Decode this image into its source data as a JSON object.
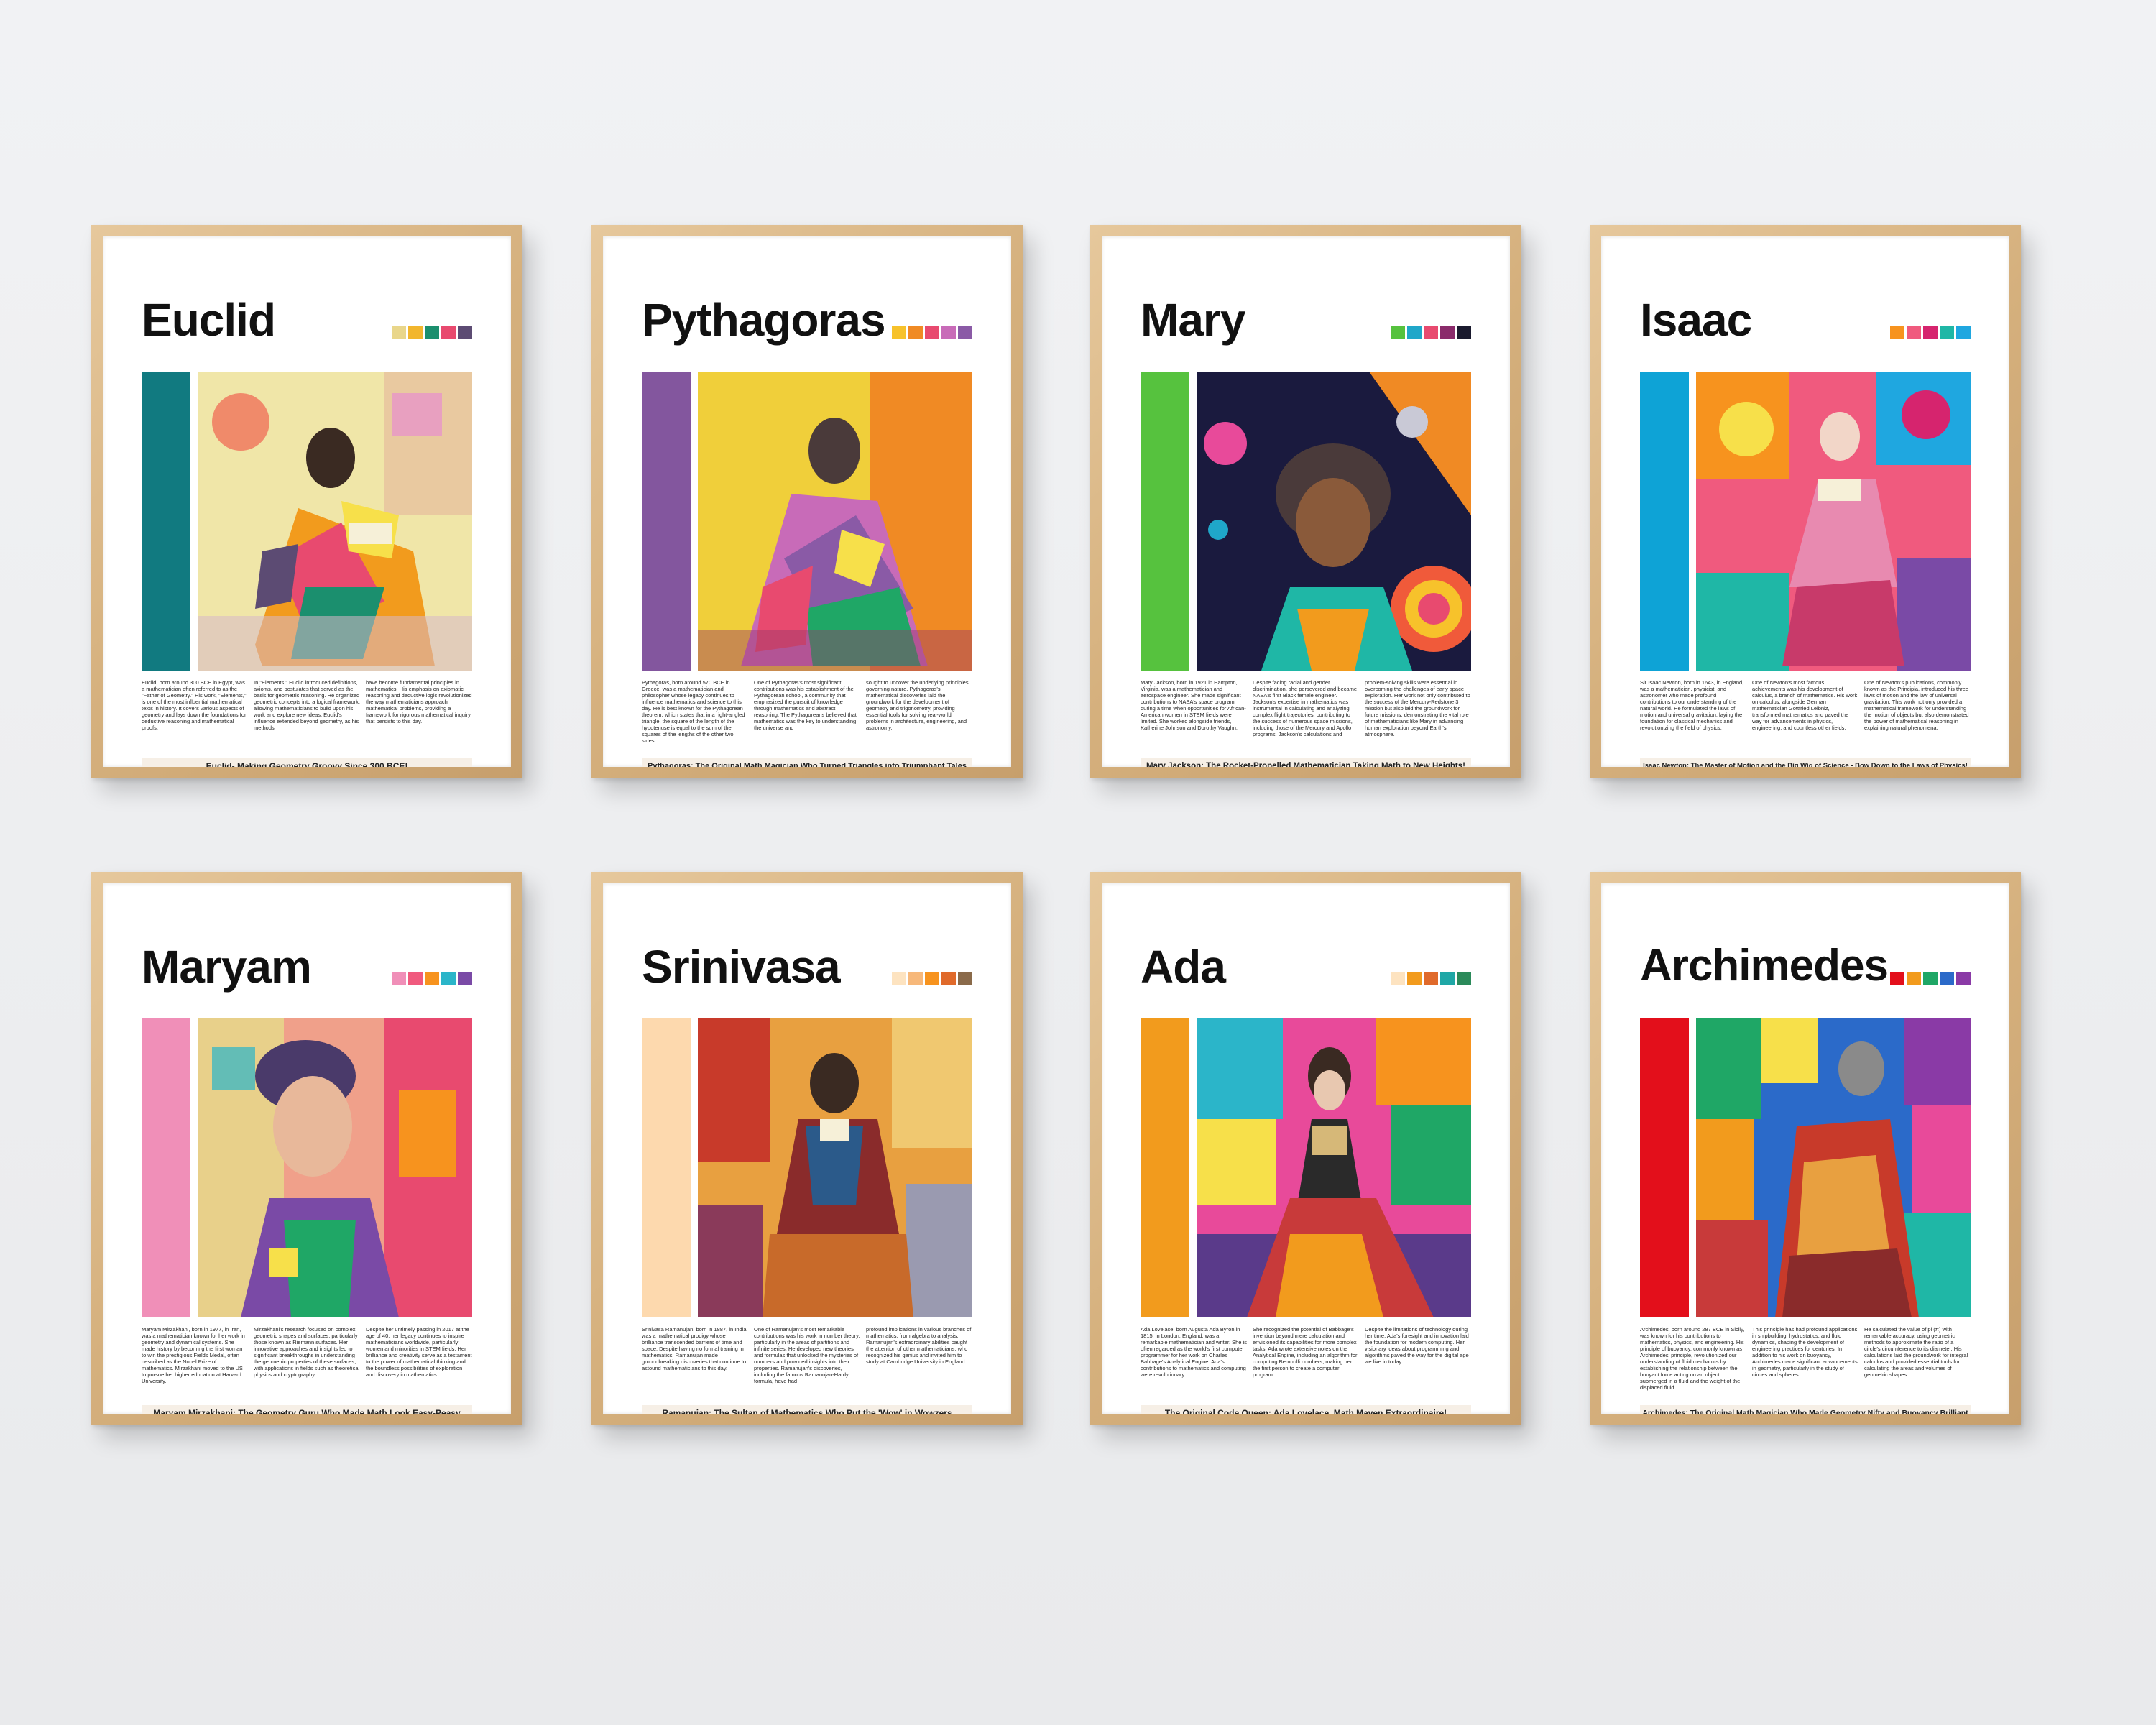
{
  "posters": [
    {
      "name": "Euclid",
      "sidebar_color": "#117a80",
      "swatches": [
        "#e9d68a",
        "#f2b62d",
        "#1b8f6e",
        "#e84a6f",
        "#5c4b73"
      ],
      "mini_swatches": [
        "#e9d68a",
        "#f2b62d",
        "#e84a6f"
      ],
      "bio": [
        "Euclid, born around 300 BCE in Egypt, was a mathematician often referred to as the \"Father of Geometry.\" His work, \"Elements,\" is one of the most influential mathematical texts in history. It covers various aspects of geometry and lays down the foundations for deductive reasoning and mathematical proofs.",
        "In \"Elements,\" Euclid introduced definitions, axioms, and postulates that served as the basis for geometric reasoning. He organized geometric concepts into a logical framework, allowing mathematicians to build upon his work and explore new ideas. Euclid's influence extended beyond geometry, as his methods",
        "have become fundamental principles in mathematics. His emphasis on axiomatic reasoning and deductive logic revolutionized the way mathematicians approach mathematical problems, providing a framework for rigorous mathematical inquiry that persists to this day."
      ],
      "tagline": "Euclid- Making Geometry Groovy Since 300 BCE!"
    },
    {
      "name": "Pythagoras",
      "sidebar_color": "#83569e",
      "swatches": [
        "#f7c22b",
        "#f08a24",
        "#e84a6f",
        "#c86bb8",
        "#8a5aa6"
      ],
      "mini_swatches": [
        "#f08a24",
        "#c86bb8",
        "#8a5aa6"
      ],
      "bio": [
        "Pythagoras, born around 570 BCE in Greece, was a mathematician and philosopher whose legacy continues to influence mathematics and science to this day. He is best known for the Pythagorean theorem, which states that in a right-angled triangle, the square of the length of the hypotenuse is equal to the sum of the squares of the lengths of the other two sides.",
        "One of Pythagoras's most significant contributions was his establishment of the Pythagorean school, a community that emphasized the pursuit of knowledge through mathematics and abstract reasoning. The Pythagoreans believed that mathematics was the key to understanding the universe and",
        "sought to uncover the underlying principles governing nature. Pythagoras's mathematical discoveries laid the groundwork for the development of geometry and trigonometry, providing essential tools for solving real-world problems in architecture, engineering, and astronomy."
      ],
      "tagline": "Pythagoras: The Original Math Magician Who Turned Triangles into Triumphant Tales"
    },
    {
      "name": "Mary",
      "sidebar_color": "#56c23e",
      "swatches": [
        "#56c23e",
        "#1fa7c9",
        "#e84a6f",
        "#8a2b6b",
        "#1a1a2e"
      ],
      "mini_swatches": [
        "#56c23e",
        "#e84a6f",
        "#1fa7c9"
      ],
      "bio": [
        "Mary Jackson, born in 1921 in Hampton, Virginia, was a mathematician and aerospace engineer. She made significant contributions to NASA's space program during a time when opportunities for African-American women in STEM fields were limited. She worked alongside friends, Katherine Johnson and Dorothy Vaughn.",
        "Despite facing racial and gender discrimination, she persevered and became NASA's first Black female engineer. Jackson's expertise in mathematics was instrumental in calculating and analyzing complex flight trajectories, contributing to the success of numerous space missions, including those of the Mercury and Apollo programs. Jackson's calculations and",
        "problem-solving skills were essential in overcoming the challenges of early space exploration. Her work not only contributed to the success of the Mercury-Redstone 3 mission but also laid the groundwork for future missions, demonstrating the vital role of mathematicians like Mary in advancing human exploration beyond Earth's atmosphere."
      ],
      "tagline": "Mary Jackson: The Rocket-Propelled Mathematician Taking Math to New Heights!"
    },
    {
      "name": "Isaac",
      "sidebar_color": "#0ea3d6",
      "swatches": [
        "#f7931e",
        "#f05a7e",
        "#d6246e",
        "#1fb7a6",
        "#1fa7e0"
      ],
      "mini_swatches": [
        "#f05a7e",
        "#d6246e",
        "#1fa7e0"
      ],
      "bio": [
        "Sir Isaac Newton, born in 1643, in England, was a mathematician, physicist, and astronomer who made profound contributions to our understanding of the natural world. He formulated the laws of motion and universal gravitation, laying the foundation for classical mechanics and revolutionizing the field of physics.",
        "One of Newton's most famous achievements was his development of calculus, a branch of mathematics. His work on calculus, alongside German mathematician Gottfried Leibniz, transformed mathematics and paved the way for advancements in physics, engineering, and countless other fields.",
        "One of Newton's publications, commonly known as the Principia, introduced his three laws of motion and the law of universal gravitation. This work not only provided a mathematical framework for understanding the motion of objects but also demonstrated the power of mathematical reasoning in explaining natural phenomena."
      ],
      "tagline": "Isaac Newton: The Master of Motion and the Big Wig of Science - Bow Down to the Laws of Physics!"
    },
    {
      "name": "Maryam",
      "sidebar_color": "#f08fb8",
      "swatches": [
        "#f08fb8",
        "#f05a7e",
        "#f7931e",
        "#2bb5c9",
        "#7a4aa6"
      ],
      "mini_swatches": [
        "#f7931e",
        "#e84a6f",
        "#7a4aa6"
      ],
      "bio": [
        "Maryam Mirzakhani, born in 1977, in Iran, was a mathematician known for her work in geometry and dynamical systems. She made history by becoming the first woman to win the prestigious Fields Medal, often described as the Nobel Prize of mathematics. Mirzakhani moved to the US to pursue her higher education at Harvard University.",
        "Mirzakhani's research focused on complex geometric shapes and surfaces, particularly those known as Riemann surfaces. Her innovative approaches and insights led to significant breakthroughs in understanding the geometric properties of these surfaces, with applications in fields such as theoretical physics and cryptography.",
        "Despite her untimely passing in 2017 at the age of 40, her legacy continues to inspire mathematicians worldwide, particularly women and minorities in STEM fields. Her brilliance and creativity serve as a testament to the power of mathematical thinking and the boundless possibilities of exploration and discovery in mathematics."
      ],
      "tagline": "Maryam Mirzakhani: The Geometry Guru Who Made Math Look Easy-Peasy"
    },
    {
      "name": "Srinivasa",
      "sidebar_color": "#fdd9ae",
      "swatches": [
        "#fde3c0",
        "#f7b87a",
        "#f7931e",
        "#e06a2b",
        "#8a6a4a"
      ],
      "mini_swatches": [
        "#f7931e",
        "#e06a2b",
        "#8a2b2b"
      ],
      "bio": [
        "Srinivasa Ramanujan, born in 1887, in India, was a mathematical prodigy whose brilliance transcended barriers of time and space. Despite having no formal training in mathematics, Ramanujan made groundbreaking discoveries that continue to astound mathematicians to this day.",
        "One of Ramanujan's most remarkable contributions was his work in number theory, particularly in the areas of partitions and infinite series. He developed new theories and formulas that unlocked the mysteries of numbers and provided insights into their properties. Ramanujan's discoveries, including the famous Ramanujan-Hardy formula, have had",
        "profound implications in various branches of mathematics, from algebra to analysis. Ramanujan's extraordinary abilities caught the attention of other mathematicians, who recognized his genius and invited him to study at Cambridge University in England."
      ],
      "tagline": "Ramanujan: The Sultan of Mathematics Who Put the 'Wow' in Wowzers"
    },
    {
      "name": "Ada",
      "sidebar_color": "#f29b1d",
      "swatches": [
        "#fde3c0",
        "#f29b1d",
        "#e06a2b",
        "#1fa7a6",
        "#2b8a5a"
      ],
      "mini_swatches": [
        "#f29b1d",
        "#1fa7a6",
        "#2b8a5a"
      ],
      "bio": [
        "Ada Lovelace, born Augusta Ada Byron in 1815, in London, England, was a remarkable mathematician and writer. She is often regarded as the world's first computer programmer for her work on Charles Babbage's Analytical Engine. Ada's contributions to mathematics and computing were revolutionary.",
        "She recognized the potential of Babbage's invention beyond mere calculation and envisioned its capabilities for more complex tasks. Ada wrote extensive notes on the Analytical Engine, including an algorithm for computing Bernoulli numbers, making her the first person to create a computer program.",
        "Despite the limitations of technology during her time, Ada's foresight and innovation laid the foundation for modern computing. Her visionary ideas about programming and algorithms paved the way for the digital age we live in today."
      ],
      "tagline": "The Original Code Queen: Ada Lovelace, Math Maven Extraordinaire!"
    },
    {
      "name": "Archimedes",
      "sidebar_color": "#e30f1b",
      "swatches": [
        "#e30f1b",
        "#f29b1d",
        "#1fa766",
        "#2b6ac9",
        "#8a3aa6"
      ],
      "mini_swatches": [
        "#e30f1b",
        "#2b6ac9",
        "#8a3aa6"
      ],
      "bio": [
        "Archimedes, born around 287 BCE in Sicily, was known for his contributions to mathematics, physics, and engineering. His principle of buoyancy, commonly known as Archimedes' principle, revolutionized our understanding of fluid mechanics by establishing the relationship between the buoyant force acting on an object submerged in a fluid and the weight of the displaced fluid.",
        "This principle has had profound applications in shipbuilding, hydrostatics, and fluid dynamics, shaping the development of engineering practices for centuries. In addition to his work on buoyancy, Archimedes made significant advancements in geometry, particularly in the study of circles and spheres.",
        "He calculated the value of pi (π) with remarkable accuracy, using geometric methods to approximate the ratio of a circle's circumference to its diameter. His calculations laid the groundwork for integral calculus and provided essential tools for calculating the areas and volumes of geometric shapes."
      ],
      "tagline": "Archimedes: The Original Math Magician Who Made Geometry Nifty and Buoyancy Brilliant"
    }
  ]
}
